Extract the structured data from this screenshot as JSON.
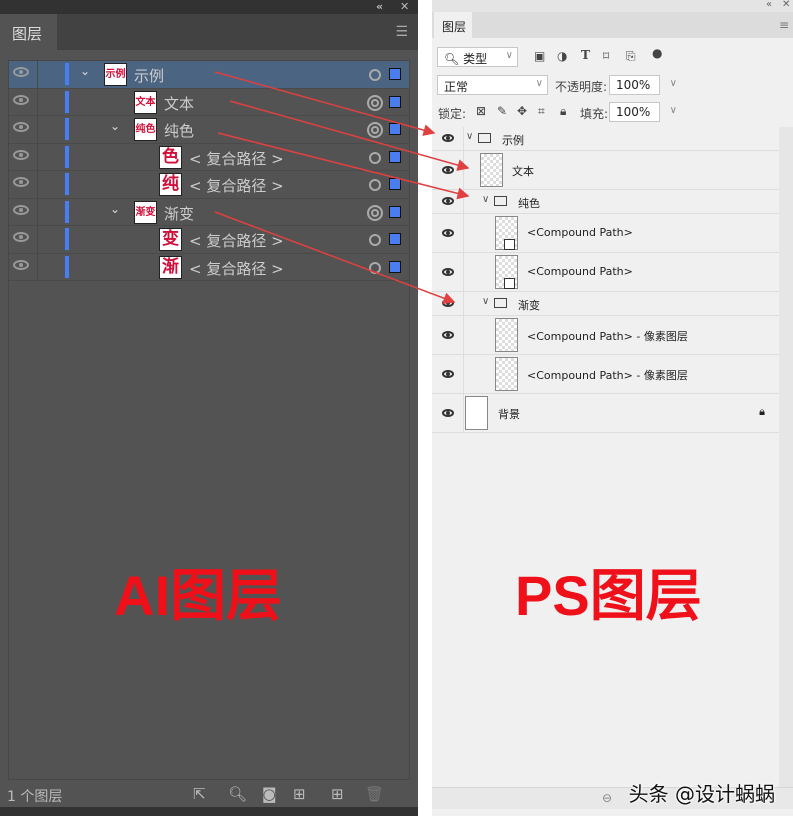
{
  "ai_panel": {
    "collapse_icon": "«",
    "close_icon": "✕",
    "tab": "图层",
    "rows": [
      {
        "name": "示例",
        "thumb": "示例",
        "level": 0,
        "expanded": true,
        "selected": true,
        "target": "single"
      },
      {
        "name": "文本",
        "thumb": "文本",
        "level": 1,
        "expanded": null,
        "target": "double"
      },
      {
        "name": "纯色",
        "thumb": "纯色",
        "level": 1,
        "expanded": true,
        "target": "double"
      },
      {
        "name": "< 复合路径 >",
        "thumb": "色",
        "level": 2,
        "target": "single"
      },
      {
        "name": "< 复合路径 >",
        "thumb": "纯",
        "level": 2,
        "target": "single"
      },
      {
        "name": "渐变",
        "thumb": "渐变",
        "level": 1,
        "expanded": true,
        "target": "double"
      },
      {
        "name": "< 复合路径 >",
        "thumb": "变",
        "level": 2,
        "target": "single"
      },
      {
        "name": "< 复合路径 >",
        "thumb": "渐",
        "level": 2,
        "target": "single"
      }
    ],
    "footer": {
      "count": "1 个图层"
    },
    "label": "AI图层"
  },
  "ps_panel": {
    "collapse_icon": "«",
    "close_icon": "✕",
    "tab": "图层",
    "filter": {
      "value": "类型"
    },
    "blend_mode": "正常",
    "opacity_label": "不透明度:",
    "opacity": "100%",
    "lock_label": "锁定:",
    "fill_label": "填充:",
    "fill": "100%",
    "rows": [
      {
        "name": "示例",
        "type": "group",
        "level": 0
      },
      {
        "name": "文本",
        "type": "layer",
        "level": 1
      },
      {
        "name": "纯色",
        "type": "group",
        "level": 1
      },
      {
        "name": "<Compound Path>",
        "type": "shape",
        "level": 2
      },
      {
        "name": "<Compound Path>",
        "type": "shape",
        "level": 2
      },
      {
        "name": "渐变",
        "type": "group",
        "level": 1
      },
      {
        "name": "<Compound Path> - 像素图层",
        "type": "layer",
        "level": 2
      },
      {
        "name": "<Compound Path> - 像素图层",
        "type": "layer",
        "level": 2
      },
      {
        "name": "背景",
        "type": "background",
        "level": 0,
        "locked": true
      }
    ],
    "label": "PS图层"
  },
  "watermark": "头条 @设计蜗蜗",
  "colors": {
    "accent": "#4a7df0",
    "annotation": "#f0101a",
    "arrow": "#e04040"
  }
}
